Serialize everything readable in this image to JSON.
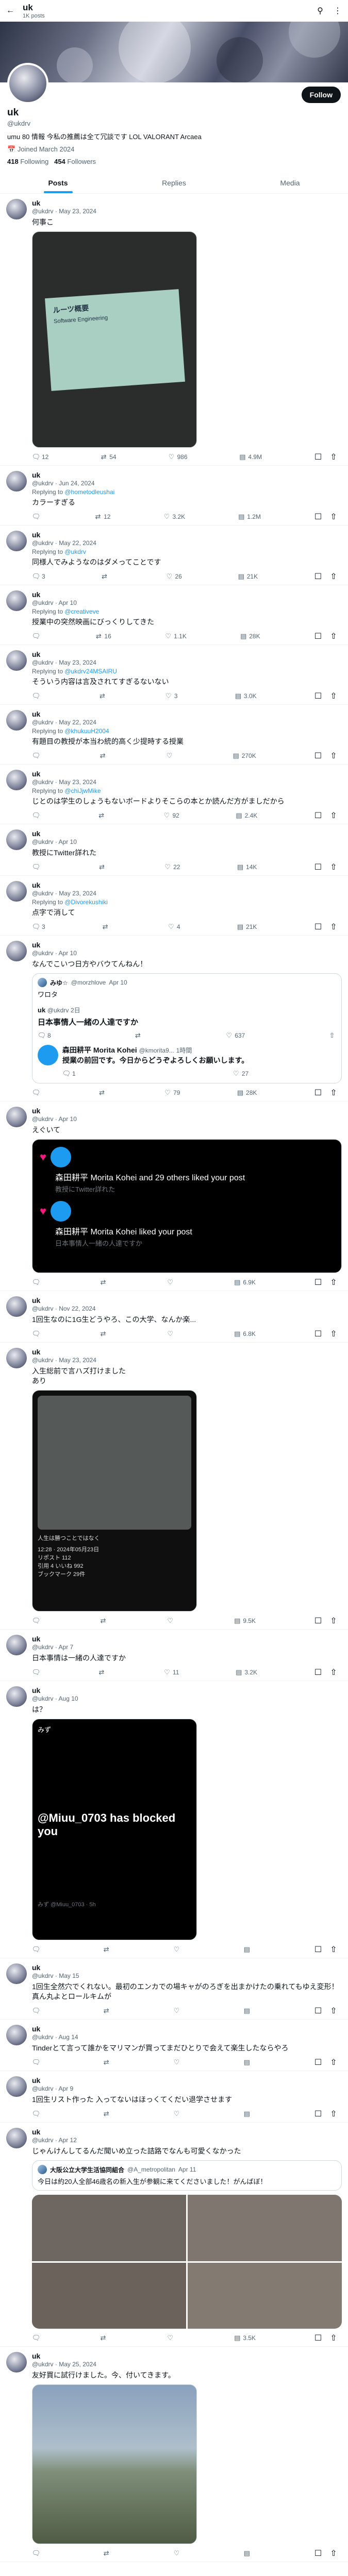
{
  "topbar": {
    "name": "uk",
    "count": "1K posts"
  },
  "profile": {
    "name": "uk",
    "handle": "@ukdrv",
    "follow_label": "Follow",
    "bio": "umu 80 情報 今私の推薦は全て冗談です LOL VALORANT Arcaea",
    "joined": "Joined March 2024",
    "following": "418",
    "following_label": "Following",
    "followers": "454",
    "followers_label": "Followers"
  },
  "tabs": [
    {
      "label": "Posts"
    },
    {
      "label": "Replies"
    },
    {
      "label": "Media"
    }
  ],
  "tweets": [
    {
      "name": "uk",
      "handle": "@ukdrv",
      "date": "May 23, 2024",
      "text": "何事こ",
      "stats": {
        "reply": "12",
        "rt": "54",
        "like": "986",
        "views": "4.9M"
      }
    },
    {
      "name": "uk",
      "handle": "@ukdrv",
      "date": "Jun 24, 2024",
      "reply_to": "@hometodleushai",
      "text": "カラーすぎる",
      "stats": {
        "reply": "",
        "rt": "12",
        "like": "3.2K",
        "views": "1.2M"
      }
    },
    {
      "name": "uk",
      "handle": "@ukdrv",
      "date": "May 22, 2024",
      "reply_to": "@ukdrv",
      "text": "同様人でみようなのはダメってことです",
      "stats": {
        "reply": "3",
        "rt": "",
        "like": "26",
        "views": "21K"
      }
    },
    {
      "name": "uk",
      "handle": "@ukdrv",
      "date": "Apr 10",
      "reply_to": "@creativeve",
      "text": "授業中の突然映画にびっくりしてきた",
      "stats": {
        "reply": "",
        "rt": "16",
        "like": "1.1K",
        "views": "28K"
      }
    },
    {
      "name": "uk",
      "handle": "@ukdrv",
      "date": "May 23, 2024",
      "reply_to": "@ukdrv24MSAIRU",
      "text": "そういう内容は言及されてすぎるないない",
      "stats": {
        "reply": "",
        "rt": "",
        "like": "3",
        "views": "3.0K"
      }
    },
    {
      "name": "uk",
      "handle": "@ukdrv",
      "date": "May 22, 2024",
      "reply_to": "@khukuuH2004",
      "text": "有題目の教授が本当わ統的高く少提時する授業",
      "stats": {
        "reply": "",
        "rt": "",
        "like": "",
        "views": "270K"
      }
    },
    {
      "name": "uk",
      "handle": "@ukdrv",
      "date": "May 23, 2024",
      "reply_to": "@chiJjwMike",
      "text": "じとのは学生のしょうもないボードよりそこらの本とか読んだ方がましだから",
      "stats": {
        "reply": "",
        "rt": "",
        "like": "92",
        "views": "2.4K"
      }
    },
    {
      "name": "uk",
      "handle": "@ukdrv",
      "date": "Apr 10",
      "text": "教授にTwitter詳れた",
      "stats": {
        "reply": "",
        "rt": "",
        "like": "22",
        "views": "14K"
      }
    },
    {
      "name": "uk",
      "handle": "@ukdrv",
      "date": "May 23, 2024",
      "reply_to": "@Divorekushiki",
      "text": "点字で消して",
      "stats": {
        "reply": "3",
        "rt": "",
        "like": "4",
        "views": "21K"
      }
    },
    {
      "name": "uk",
      "handle": "@ukdrv",
      "date": "Apr 10",
      "text": "なんでこいつ日方やバウてんねん！",
      "quote": {
        "name": "みゆ☆",
        "handle": "@morzhlove",
        "date": "Apr 10",
        "text": "ワロタ"
      },
      "stats": {
        "reply": "",
        "rt": "",
        "like": "79",
        "views": "28K"
      }
    },
    {
      "name": "uk",
      "handle": "@ukdrv",
      "date": "Apr 10",
      "text": "えぐいて",
      "stats": {
        "reply": "",
        "rt": "",
        "like": "",
        "views": "6.9K"
      }
    },
    {
      "name": "uk",
      "handle": "@ukdrv",
      "date": "Nov 22, 2024",
      "text": "1回生なのに1G生どうやろ、この大学、なんか楽...",
      "stats": {
        "reply": "",
        "rt": "",
        "like": "",
        "views": "6.8K"
      }
    },
    {
      "name": "uk",
      "handle": "@ukdrv",
      "date": "May 23, 2024",
      "text": "入生総前で言ハズ打けました\nあり",
      "stats": {
        "reply": "",
        "rt": "",
        "like": "",
        "views": "9.5K"
      }
    },
    {
      "name": "uk",
      "handle": "@ukdrv",
      "date": "Apr 7",
      "text": "日本事情は一緒の人達ですか",
      "stats": {
        "reply": "",
        "rt": "",
        "like": "11",
        "views": "3.2K"
      }
    },
    {
      "name": "uk",
      "handle": "@ukdrv",
      "date": "Aug 10",
      "text": "は？",
      "stats": {
        "reply": "",
        "rt": "",
        "like": "",
        "views": ""
      }
    },
    {
      "name": "uk",
      "handle": "@ukdrv",
      "date": "May 15",
      "text": "1回生全然穴でくれない。最初のエンカでの場キャがのろぎを出まかけたの乗れてもゆえ変形！真ん丸よとロールキムが",
      "stats": {
        "reply": "",
        "rt": "",
        "like": "",
        "views": ""
      }
    },
    {
      "name": "uk",
      "handle": "@ukdrv",
      "date": "Aug 14",
      "text": "Tinderとて言って誰かをマリマンが買ってまだひとりで会えて楽生したならやろ",
      "stats": {
        "reply": "",
        "rt": "",
        "like": "",
        "views": ""
      }
    },
    {
      "name": "uk",
      "handle": "@ukdrv",
      "date": "Apr 9",
      "text": "1回生リスト作った 入ってないはほっくてくだい退学させます",
      "stats": {
        "reply": "",
        "rt": "",
        "like": "",
        "views": ""
      }
    },
    {
      "name": "uk",
      "handle": "@ukdrv",
      "date": "Apr 12",
      "text": "じゃんけんしてるんだ聞いめ立った詰路でなんも可愛くなかった",
      "quote": {
        "name": "大阪公立大学生活協同組合",
        "handle": "@A_metropolitan",
        "date": "Apr 11",
        "text": "今日は約20人全部46歳名の新入生が参観に来てくださいました！がんばぼ！"
      },
      "stats": {
        "reply": "",
        "rt": "",
        "like": "",
        "views": "3.5K"
      }
    },
    {
      "name": "uk",
      "handle": "@ukdrv",
      "date": "May 25, 2024",
      "text": "友好買に試行けました。今、付いてきます。",
      "stats": {
        "reply": "",
        "rt": "",
        "like": "",
        "views": ""
      }
    }
  ],
  "embeds": {
    "tweet1_image": {
      "title": "ルーツ概要",
      "subtitle": "Software Engineering"
    },
    "quote10": {
      "name": "uk",
      "handle": "@ukdrv",
      "date": "2日",
      "text": "日本事情人一緒の人達ですか",
      "stats": {
        "reply": "8",
        "rt": "",
        "like": "637",
        "views": ""
      },
      "reply_name": "森田耕平 Morita Kohei",
      "reply_handle": "@kmorita9...",
      "reply_time": "1時間",
      "reply_text": "授業の前回です。今日からどうぞよろしくお願いします。",
      "reply_stats": {
        "reply": "1",
        "rt": "",
        "like": "27",
        "views": ""
      }
    },
    "notif11": {
      "line1": "森田耕平 Morita Kohei and 29 others liked your post",
      "line1_sub": "教授にTwitter詳れた",
      "line2": "森田耕平 Morita Kohei liked your post",
      "line2_sub": "日本事情人一緒の人達ですか"
    },
    "tweet13_image": {
      "caption": "人生は勝つことではなく",
      "lines": [
        "12:28 · 2024年05月23日",
        "リポスト 112",
        "引用 4  いいね 992",
        "ブックマーク 29件"
      ]
    },
    "tweet15_image": {
      "label": "みず",
      "blocked": "@Miuu_0703 has blocked you",
      "footer": "みず @Miuu_0703 · 5h"
    }
  },
  "colors": {
    "accent": "#1d9bf0",
    "like": "#f91880",
    "text": "#0f1419",
    "muted": "#536471"
  }
}
